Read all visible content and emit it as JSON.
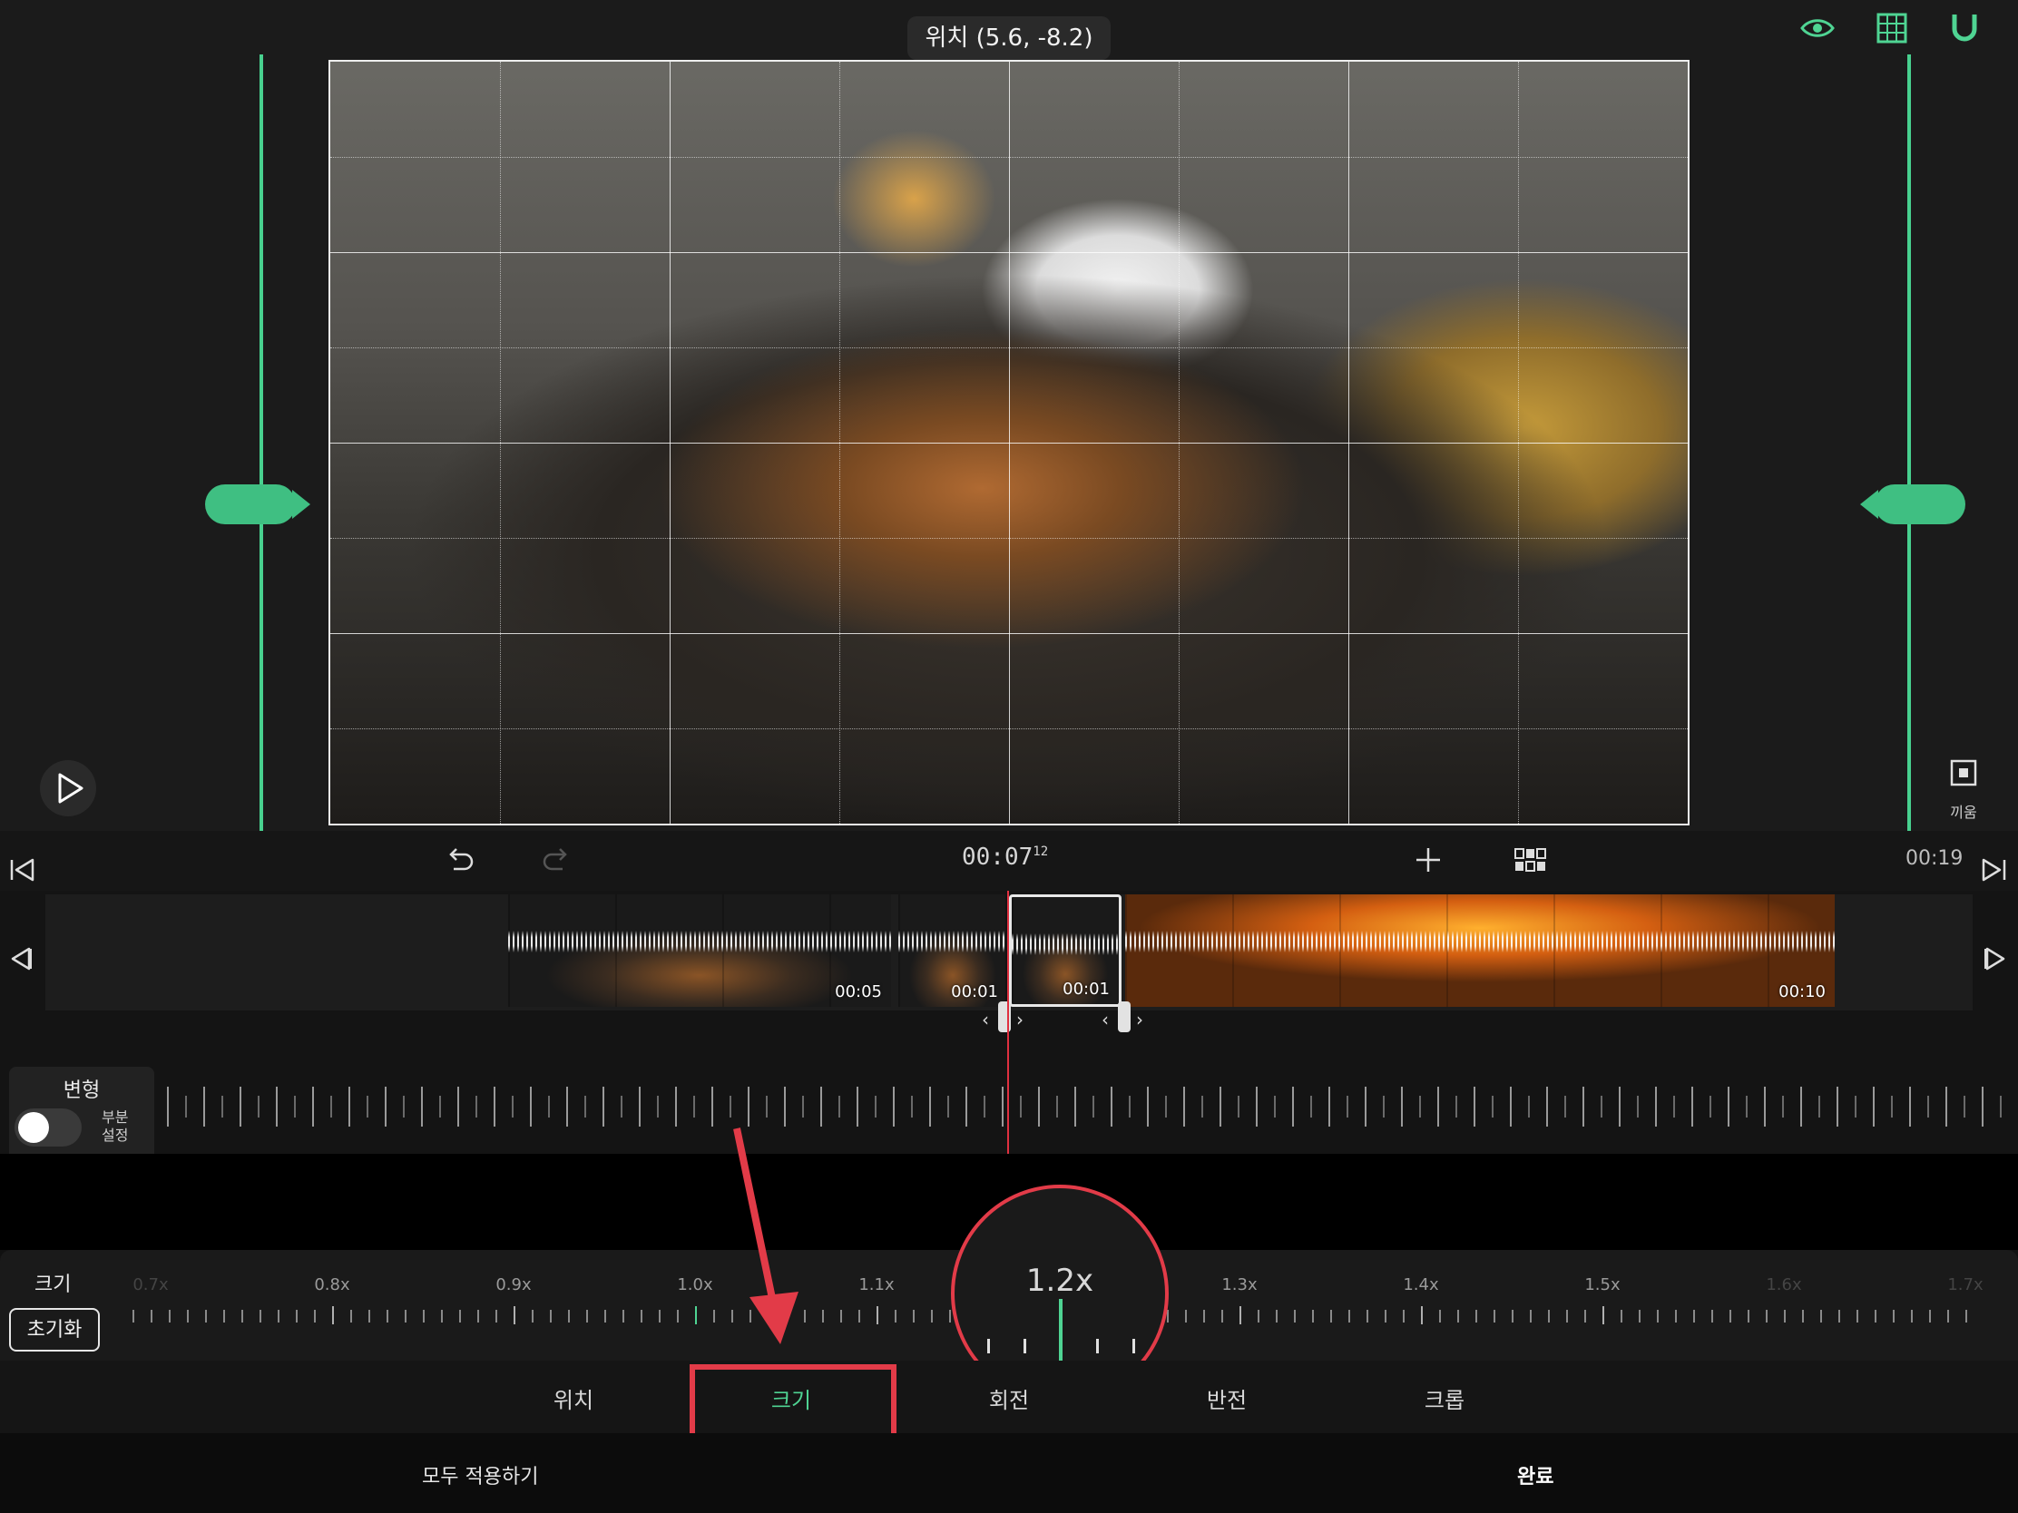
{
  "preview": {
    "position_tooltip": "위치 (5.6, -8.2)",
    "fit_label": "끼움"
  },
  "top_icons": [
    "eye-icon",
    "grid-icon",
    "magnet-icon"
  ],
  "transport": {
    "timecode_main": "00:07",
    "timecode_frames": "12",
    "duration": "00:19"
  },
  "timeline": {
    "clips": [
      {
        "duration": "00:05"
      },
      {
        "duration": "00:01"
      },
      {
        "duration": "00:01"
      },
      {
        "duration": "00:10"
      }
    ]
  },
  "keyframe_panel": {
    "title": "변형",
    "toggle_label": "부분\n설정"
  },
  "scale": {
    "label": "크기",
    "reset_label": "초기화",
    "current_value": "1.2x",
    "ticks": [
      "0.7x",
      "0.8x",
      "0.9x",
      "1.0x",
      "1.1x",
      "1.3x",
      "1.4x",
      "1.5x",
      "1.6x",
      "1.7x"
    ]
  },
  "tabs": {
    "items": [
      "위치",
      "크기",
      "회전",
      "반전",
      "크롭"
    ],
    "active": "크기"
  },
  "bottom": {
    "apply_all": "모두 적용하기",
    "done": "완료"
  },
  "colors": {
    "accent": "#4fd493",
    "annotation": "#e23b48",
    "playhead": "#e03040"
  }
}
